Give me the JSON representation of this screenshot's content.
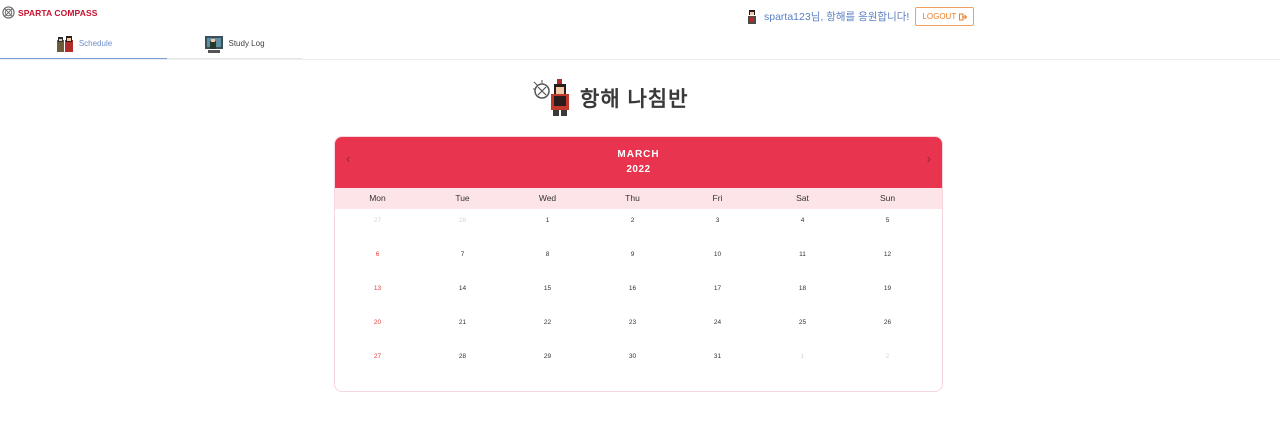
{
  "brand": {
    "name": "SPARTA COMPASS",
    "icon": "compass-icon"
  },
  "tabs": [
    {
      "label": "Schedule",
      "icon": "characters-icon",
      "active": true
    },
    {
      "label": "Study Log",
      "icon": "monitor-icon",
      "active": false
    }
  ],
  "user": {
    "greeting": "sparta123님, 항해를 응원합니다!",
    "avatar_icon": "avatar-icon"
  },
  "logout": {
    "label": "LOGOUT",
    "icon": "logout-icon"
  },
  "page": {
    "title": "항해 나침반",
    "icon": "warrior-compass-icon"
  },
  "calendar": {
    "month": "MARCH",
    "year": "2022",
    "prev_icon": "chevron-left-icon",
    "next_icon": "chevron-right-icon",
    "weekdays": [
      "Mon",
      "Tue",
      "Wed",
      "Thu",
      "Fri",
      "Sat",
      "Sun"
    ],
    "weeks": [
      [
        "27",
        "28",
        "1",
        "2",
        "3",
        "4",
        "5"
      ],
      [
        "6",
        "7",
        "8",
        "9",
        "10",
        "11",
        "12"
      ],
      [
        "13",
        "14",
        "15",
        "16",
        "17",
        "18",
        "19"
      ],
      [
        "20",
        "21",
        "22",
        "23",
        "24",
        "25",
        "26"
      ],
      [
        "27",
        "28",
        "29",
        "30",
        "31",
        "1",
        "2"
      ]
    ],
    "muted_cells": [
      [
        0,
        0
      ],
      [
        0,
        1
      ],
      [
        4,
        5
      ],
      [
        4,
        6
      ]
    ],
    "highlight_color": "#e23c3c",
    "header_color": "#e8344e",
    "weekday_bg": "#fde4e8"
  }
}
